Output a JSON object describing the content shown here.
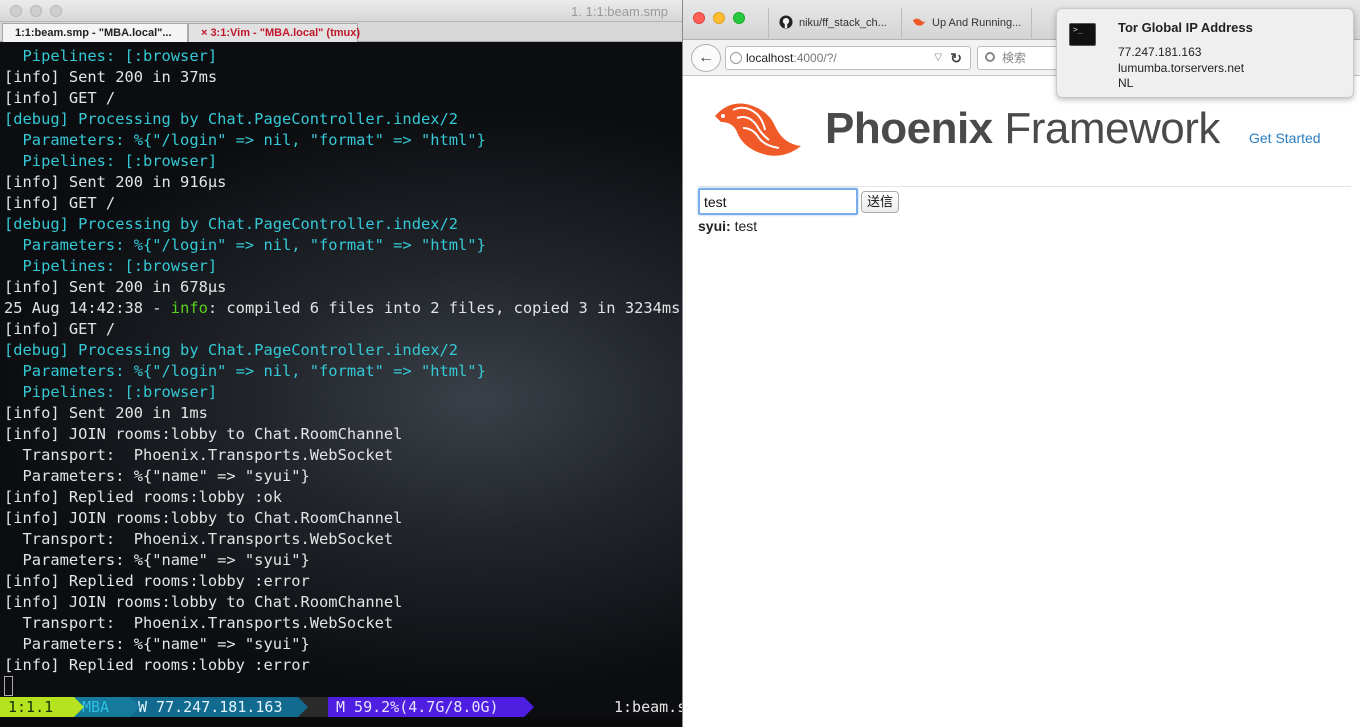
{
  "terminal": {
    "window_title": "1. 1:1:beam.smp",
    "tabs": [
      {
        "label": "1:1:beam.smp - \"MBA.local\"..."
      },
      {
        "label": "3:1:Vim - \"MBA.local\" (tmux)",
        "close": "×"
      }
    ],
    "log_lines": [
      {
        "segments": [
          {
            "t": "  Pipelines: [:browser]",
            "c": "dbg"
          }
        ]
      },
      {
        "segments": [
          {
            "t": "[info] Sent 200 in 37ms",
            "c": ""
          }
        ]
      },
      {
        "segments": [
          {
            "t": "[info] GET /",
            "c": ""
          }
        ]
      },
      {
        "segments": [
          {
            "t": "[debug] Processing by Chat.PageController.index/2",
            "c": "dbg"
          }
        ]
      },
      {
        "segments": [
          {
            "t": "  Parameters: %{\"/login\" => nil, \"format\" => \"html\"}",
            "c": "dbg"
          }
        ]
      },
      {
        "segments": [
          {
            "t": "  Pipelines: [:browser]",
            "c": "dbg"
          }
        ]
      },
      {
        "segments": [
          {
            "t": "[info] Sent 200 in 916µs",
            "c": ""
          }
        ]
      },
      {
        "segments": [
          {
            "t": "[info] GET /",
            "c": ""
          }
        ]
      },
      {
        "segments": [
          {
            "t": "[debug] Processing by Chat.PageController.index/2",
            "c": "dbg"
          }
        ]
      },
      {
        "segments": [
          {
            "t": "  Parameters: %{\"/login\" => nil, \"format\" => \"html\"}",
            "c": "dbg"
          }
        ]
      },
      {
        "segments": [
          {
            "t": "  Pipelines: [:browser]",
            "c": "dbg"
          }
        ]
      },
      {
        "segments": [
          {
            "t": "[info] Sent 200 in 678µs",
            "c": ""
          }
        ]
      },
      {
        "segments": [
          {
            "t": "25 Aug 14:42:38 - ",
            "c": ""
          },
          {
            "t": "info",
            "c": "ok"
          },
          {
            "t": ": compiled 6 files into 2 files, copied 3 in 3234ms",
            "c": ""
          }
        ]
      },
      {
        "segments": [
          {
            "t": "[info] GET /",
            "c": ""
          }
        ]
      },
      {
        "segments": [
          {
            "t": "[debug] Processing by Chat.PageController.index/2",
            "c": "dbg"
          }
        ]
      },
      {
        "segments": [
          {
            "t": "  Parameters: %{\"/login\" => nil, \"format\" => \"html\"}",
            "c": "dbg"
          }
        ]
      },
      {
        "segments": [
          {
            "t": "  Pipelines: [:browser]",
            "c": "dbg"
          }
        ]
      },
      {
        "segments": [
          {
            "t": "[info] Sent 200 in 1ms",
            "c": ""
          }
        ]
      },
      {
        "segments": [
          {
            "t": "[info] JOIN rooms:lobby to Chat.RoomChannel",
            "c": ""
          }
        ]
      },
      {
        "segments": [
          {
            "t": "  Transport:  Phoenix.Transports.WebSocket",
            "c": ""
          }
        ]
      },
      {
        "segments": [
          {
            "t": "  Parameters: %{\"name\" => \"syui\"}",
            "c": ""
          }
        ]
      },
      {
        "segments": [
          {
            "t": "[info] Replied rooms:lobby :ok",
            "c": ""
          }
        ]
      },
      {
        "segments": [
          {
            "t": "[info] JOIN rooms:lobby to Chat.RoomChannel",
            "c": ""
          }
        ]
      },
      {
        "segments": [
          {
            "t": "  Transport:  Phoenix.Transports.WebSocket",
            "c": ""
          }
        ]
      },
      {
        "segments": [
          {
            "t": "  Parameters: %{\"name\" => \"syui\"}",
            "c": ""
          }
        ]
      },
      {
        "segments": [
          {
            "t": "[info] Replied rooms:lobby :error",
            "c": ""
          }
        ]
      },
      {
        "segments": [
          {
            "t": "[info] JOIN rooms:lobby to Chat.RoomChannel",
            "c": ""
          }
        ]
      },
      {
        "segments": [
          {
            "t": "  Transport:  Phoenix.Transports.WebSocket",
            "c": ""
          }
        ]
      },
      {
        "segments": [
          {
            "t": "  Parameters: %{\"name\" => \"syui\"}",
            "c": ""
          }
        ]
      },
      {
        "segments": [
          {
            "t": "[info] Replied rooms:lobby :error",
            "c": ""
          }
        ]
      }
    ],
    "status": {
      "window_index": "1:1.1",
      "host": "MBA",
      "ip": "W 77.247.181.163",
      "apple": "",
      "memory": "M 59.2%(4.7G/8.0G)",
      "process": "1:beam.s"
    }
  },
  "browser": {
    "tabs": [
      {
        "label": "niku/ff_stack_ch...",
        "icon": "github-icon"
      },
      {
        "label": "Up And Running...",
        "icon": "phoenix-icon"
      }
    ],
    "url_host": "localhost",
    "url_rest": ":4000/?/",
    "search_placeholder": "検索",
    "page": {
      "brand_bold": "Phoenix",
      "brand_light": " Framework",
      "get_started": "Get Started",
      "input_value": "test",
      "send_label": "送信",
      "message_user": "syui:",
      "message_text": " test"
    }
  },
  "notification": {
    "title": "Tor Global IP Address",
    "icon_text": ">_",
    "ip": "77.247.181.163",
    "host": "lumumba.torservers.net",
    "country": "NL"
  },
  "colors": {
    "debug_cyan": "#35c9d6",
    "info_green": "#5cd11c",
    "phoenix_orange": "#f05a28",
    "link_blue": "#2c7dc0"
  }
}
